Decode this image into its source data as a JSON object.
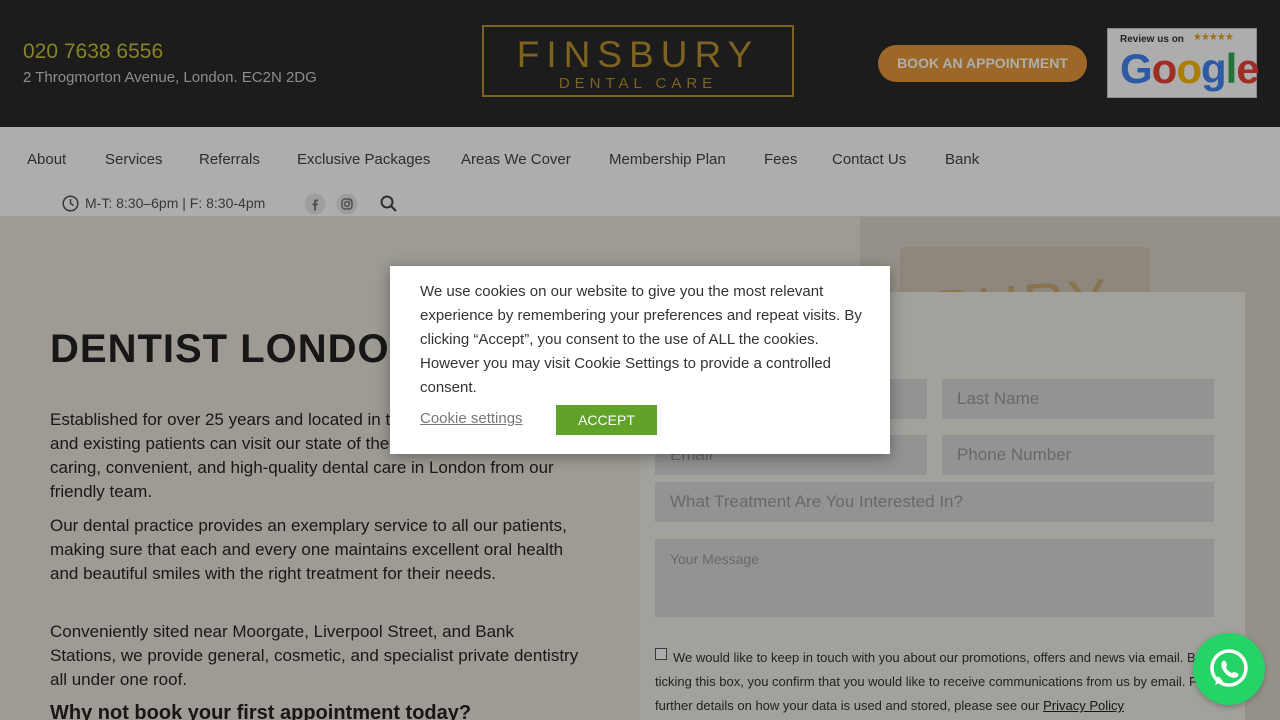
{
  "header": {
    "phone": "020 7638 6556",
    "address": "2 Throgmorton Avenue, London. EC2N 2DG",
    "logo_main": "FINSBURY",
    "logo_sub": "DENTAL CARE",
    "book_button": "BOOK AN APPOINTMENT",
    "review_label": "Review us on",
    "review_stars": "★★★★★",
    "google": [
      "G",
      "o",
      "o",
      "g",
      "l",
      "e"
    ]
  },
  "nav": {
    "items": [
      "About",
      "Services",
      "Referrals",
      "Exclusive Packages",
      "Areas We Cover",
      "Membership Plan",
      "Fees",
      "Contact Us",
      "Bank"
    ],
    "hours": "M-T: 8:30–6pm | F: 8:30-4pm"
  },
  "hero": {
    "title": "DENTIST LONDON",
    "paragraphs": [
      "Established for over 25 years and located in the heart of London, new and existing patients can visit our state of the art premises to receive caring, convenient, and high-quality dental care in London from our friendly team.",
      "Our dental practice provides an exemplary service to all our patients, making sure that each and every one maintains excellent oral health and beautiful smiles with the right treatment for their needs.",
      "Conveniently sited near Moorgate, Liverpool Street, and Bank Stations, we provide general, cosmetic, and specialist private dentistry all under one roof."
    ],
    "cta": "Why not book your first appointment today?",
    "background_text": "BURY"
  },
  "form": {
    "last_name": "Last Name",
    "email": "Email",
    "phone": "Phone Number",
    "treatment": "What Treatment Are You Interested In?",
    "message": "Your Message",
    "consent_text": "We would like to keep in touch with you about our promotions, offers and news via email. By ticking this box, you confirm that you would like to receive communications from us by email. For further details on how your data is used and stored, please see our",
    "privacy_link": "Privacy Policy"
  },
  "cookie": {
    "message": "We use cookies on our website to give you the most relevant experience by remembering your preferences and repeat visits. By clicking “Accept”, you consent to the use of ALL the cookies. However you may visit Cookie Settings to provide a controlled consent.",
    "settings_label": "Cookie settings",
    "accept_label": "ACCEPT"
  },
  "colors": {
    "header_bg": "#2a2a2a",
    "phone": "#c6c13d",
    "gold": "#b8922e",
    "book_button": "#e89a3a",
    "accept_button": "#61a229",
    "whatsapp": "#25d366"
  },
  "icons": [
    "clock-icon",
    "facebook-icon",
    "instagram-icon",
    "search-icon",
    "whatsapp-icon"
  ]
}
